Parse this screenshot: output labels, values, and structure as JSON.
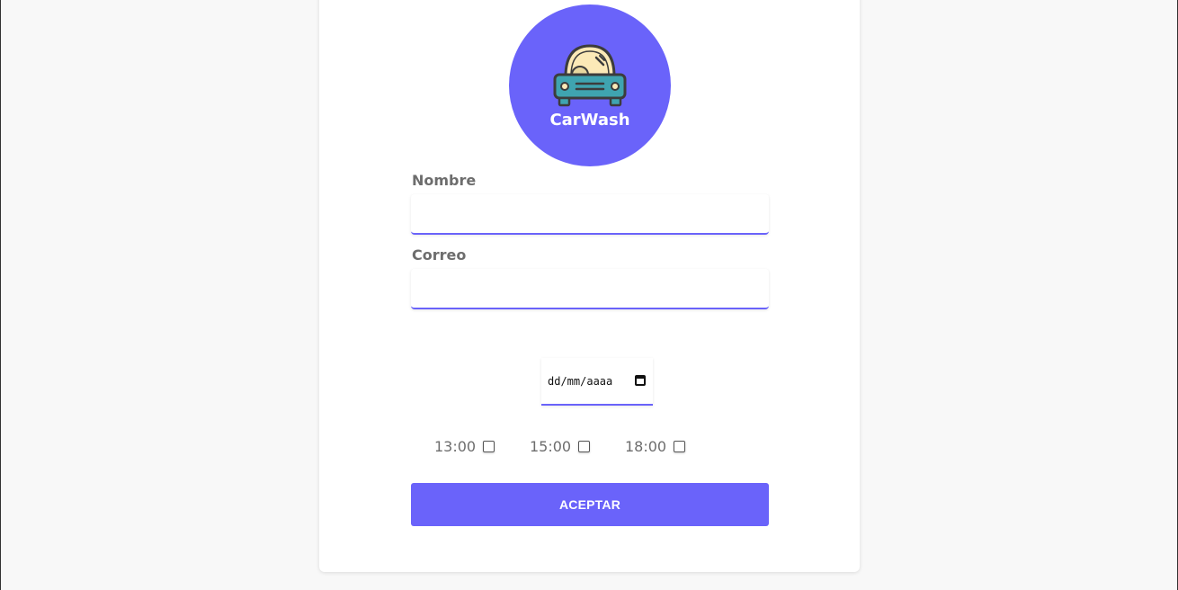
{
  "brand": {
    "name": "CarWash",
    "accent": "#6a63fa",
    "icon": "car-icon"
  },
  "form": {
    "name_label": "Nombre",
    "name_value": "",
    "email_label": "Correo",
    "email_value": "",
    "date_placeholder": "dd/mm/aaaa",
    "times": [
      {
        "label": "13:00",
        "checked": false
      },
      {
        "label": "15:00",
        "checked": false
      },
      {
        "label": "18:00",
        "checked": false
      }
    ],
    "submit_label": "ACEPTAR"
  }
}
